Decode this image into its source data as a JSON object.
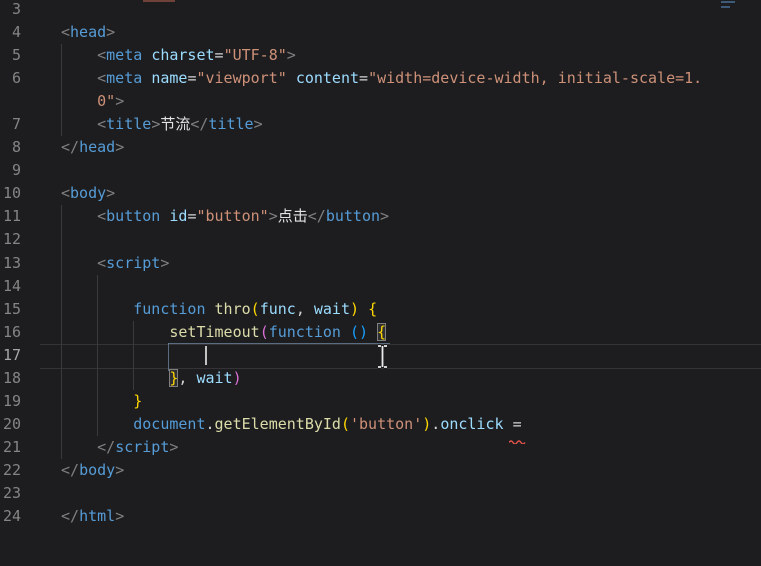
{
  "editor": {
    "language_appearance": "html",
    "cursor": {
      "line": "17",
      "caret_visible": true
    },
    "error": {
      "line": "20",
      "under_text": "=",
      "style": "red-squiggle"
    },
    "rows": [
      {
        "num": "3",
        "segs": []
      },
      {
        "num": "4",
        "segs": [
          [
            "punct",
            "<"
          ],
          [
            "tag",
            "head"
          ],
          [
            "punct",
            ">"
          ]
        ]
      },
      {
        "num": "5",
        "segs": [
          [
            "plain",
            "    "
          ],
          [
            "punct",
            "<"
          ],
          [
            "tag",
            "meta"
          ],
          [
            "plain",
            " "
          ],
          [
            "attr",
            "charset"
          ],
          [
            "plain",
            "="
          ],
          [
            "str",
            "\"UTF-8\""
          ],
          [
            "punct",
            ">"
          ]
        ]
      },
      {
        "num": "6",
        "segs": [
          [
            "plain",
            "    "
          ],
          [
            "punct",
            "<"
          ],
          [
            "tag",
            "meta"
          ],
          [
            "plain",
            " "
          ],
          [
            "attr",
            "name"
          ],
          [
            "plain",
            "="
          ],
          [
            "str",
            "\"viewport\""
          ],
          [
            "plain",
            " "
          ],
          [
            "attr",
            "content"
          ],
          [
            "plain",
            "="
          ],
          [
            "str",
            "\"width=device-width, initial-scale=1."
          ]
        ]
      },
      {
        "num": "",
        "segs": [
          [
            "plain",
            "    "
          ],
          [
            "str",
            "0\""
          ],
          [
            "punct",
            ">"
          ]
        ]
      },
      {
        "num": "7",
        "segs": [
          [
            "plain",
            "    "
          ],
          [
            "punct",
            "<"
          ],
          [
            "tag",
            "title"
          ],
          [
            "punct",
            ">"
          ],
          [
            "cjk",
            "节流"
          ],
          [
            "punct",
            "</"
          ],
          [
            "tag",
            "title"
          ],
          [
            "punct",
            ">"
          ]
        ]
      },
      {
        "num": "8",
        "segs": [
          [
            "punct",
            "</"
          ],
          [
            "tag",
            "head"
          ],
          [
            "punct",
            ">"
          ]
        ]
      },
      {
        "num": "9",
        "segs": []
      },
      {
        "num": "10",
        "segs": [
          [
            "punct",
            "<"
          ],
          [
            "tag",
            "body"
          ],
          [
            "punct",
            ">"
          ]
        ]
      },
      {
        "num": "11",
        "segs": [
          [
            "plain",
            "    "
          ],
          [
            "punct",
            "<"
          ],
          [
            "tag",
            "button"
          ],
          [
            "plain",
            " "
          ],
          [
            "attr",
            "id"
          ],
          [
            "plain",
            "="
          ],
          [
            "str",
            "\"button\""
          ],
          [
            "punct",
            ">"
          ],
          [
            "cjk",
            "点击"
          ],
          [
            "punct",
            "</"
          ],
          [
            "tag",
            "button"
          ],
          [
            "punct",
            ">"
          ]
        ]
      },
      {
        "num": "12",
        "segs": []
      },
      {
        "num": "13",
        "segs": [
          [
            "plain",
            "    "
          ],
          [
            "punct",
            "<"
          ],
          [
            "tag",
            "script"
          ],
          [
            "punct",
            ">"
          ]
        ]
      },
      {
        "num": "14",
        "segs": []
      },
      {
        "num": "15",
        "segs": [
          [
            "plain",
            "        "
          ],
          [
            "kw",
            "function"
          ],
          [
            "plain",
            " "
          ],
          [
            "fn",
            "thro"
          ],
          [
            "b1",
            "("
          ],
          [
            "param",
            "func"
          ],
          [
            "plain",
            ", "
          ],
          [
            "param",
            "wait"
          ],
          [
            "b1",
            ")"
          ],
          [
            "plain",
            " "
          ],
          [
            "b1",
            "{"
          ]
        ]
      },
      {
        "num": "16",
        "segs": [
          [
            "plain",
            "            "
          ],
          [
            "fn",
            "setTimeout"
          ],
          [
            "b2",
            "("
          ],
          [
            "kw",
            "function"
          ],
          [
            "plain",
            " "
          ],
          [
            "b3",
            "()"
          ],
          [
            "plain",
            " "
          ],
          [
            "b1 boxed",
            "{"
          ]
        ]
      },
      {
        "num": "17",
        "current": true,
        "segs": []
      },
      {
        "num": "18",
        "segs": [
          [
            "plain",
            "            "
          ],
          [
            "b1 boxed",
            "}"
          ],
          [
            "plain",
            ", "
          ],
          [
            "param",
            "wait"
          ],
          [
            "b2",
            ")"
          ]
        ]
      },
      {
        "num": "19",
        "segs": [
          [
            "plain",
            "        "
          ],
          [
            "b1",
            "}"
          ]
        ]
      },
      {
        "num": "20",
        "segs": [
          [
            "plain",
            "        "
          ],
          [
            "kw",
            "document"
          ],
          [
            "plain",
            "."
          ],
          [
            "fn",
            "getElementById"
          ],
          [
            "b1",
            "("
          ],
          [
            "str",
            "'button'"
          ],
          [
            "b1",
            ")"
          ],
          [
            "plain",
            "."
          ],
          [
            "prop",
            "onclick"
          ],
          [
            "plain",
            " "
          ],
          [
            "plain",
            "="
          ]
        ]
      },
      {
        "num": "21",
        "segs": [
          [
            "plain",
            "    "
          ],
          [
            "punct",
            "</"
          ],
          [
            "tag",
            "script"
          ],
          [
            "punct",
            ">"
          ]
        ]
      },
      {
        "num": "22",
        "segs": [
          [
            "punct",
            "</"
          ],
          [
            "tag",
            "body"
          ],
          [
            "punct",
            ">"
          ]
        ]
      },
      {
        "num": "23",
        "segs": []
      },
      {
        "num": "24",
        "segs": [
          [
            "punct",
            "</"
          ],
          [
            "tag",
            "html"
          ],
          [
            "punct",
            ">"
          ]
        ]
      }
    ],
    "colors": {
      "background": "#1d1d20",
      "line_number": "#858585",
      "tag": "#569cd6",
      "attribute": "#9cdcfe",
      "string": "#ce9178",
      "punctuation": "#808080",
      "plain_text": "#d4d4d4",
      "keyword": "#569cd6",
      "function_name": "#dcdcaa",
      "parameter": "#9cdcfe",
      "property": "#9cdcfe",
      "bracket_level1": "#ffd700",
      "bracket_level2": "#da70d6",
      "bracket_level3": "#179fff",
      "error_squiggle": "#e15349",
      "caret": "#c2c2c2"
    }
  }
}
